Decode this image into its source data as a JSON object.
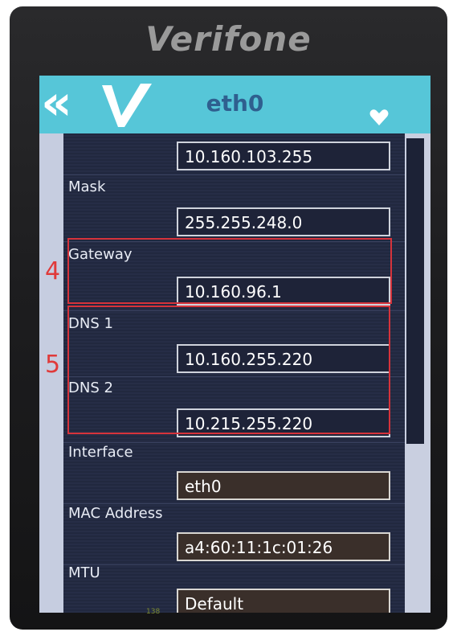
{
  "device": {
    "brand": "Verifone"
  },
  "header": {
    "title": "eth0"
  },
  "fields": [
    {
      "label": "",
      "value": "10.160.103.255"
    },
    {
      "label": "Mask",
      "value": "255.255.248.0"
    },
    {
      "label": "Gateway",
      "value": "10.160.96.1"
    },
    {
      "label": "DNS 1",
      "value": "10.160.255.220"
    },
    {
      "label": "DNS 2",
      "value": "10.215.255.220"
    },
    {
      "label": "Interface",
      "value": "eth0"
    },
    {
      "label": "MAC Address",
      "value": "a4:60:11:1c:01:26"
    },
    {
      "label": "MTU",
      "value": "Default"
    }
  ],
  "annotations": {
    "marker_gateway": "4",
    "marker_dns": "5"
  },
  "footer": {
    "tiny": "138"
  },
  "colors": {
    "titlebar": "#56c6d8",
    "highlight": "#d6333b"
  }
}
